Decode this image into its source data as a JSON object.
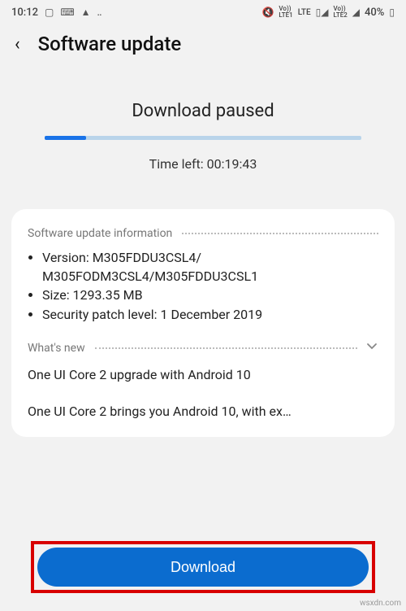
{
  "statusbar": {
    "time": "10:12",
    "left_icons": [
      "image-icon",
      "monitor-icon",
      "warning-icon",
      "more-icon"
    ],
    "right_text": "40%",
    "mute_icon": "mute-icon",
    "lte1": "LTE1",
    "lte2": "LTE2",
    "lte": "LTE"
  },
  "header": {
    "title": "Software update"
  },
  "status": {
    "title": "Download paused",
    "time_left": "Time left: 00:19:43",
    "progress_percent": 13
  },
  "info": {
    "section_title": "Software update information",
    "version_label": "Version: M305FDDU3CSL4/ M305FODM3CSL4/M305FDDU3CSL1",
    "size_label": "Size: 1293.35 MB",
    "security_label": "Security patch level: 1 December 2019"
  },
  "whatsnew": {
    "section_title": "What's new",
    "line1": "One UI Core 2 upgrade with Android 10",
    "line2": "One UI Core 2 brings you Android 10, with ex…"
  },
  "button": {
    "download": "Download"
  },
  "watermark": "wsxdn.com"
}
